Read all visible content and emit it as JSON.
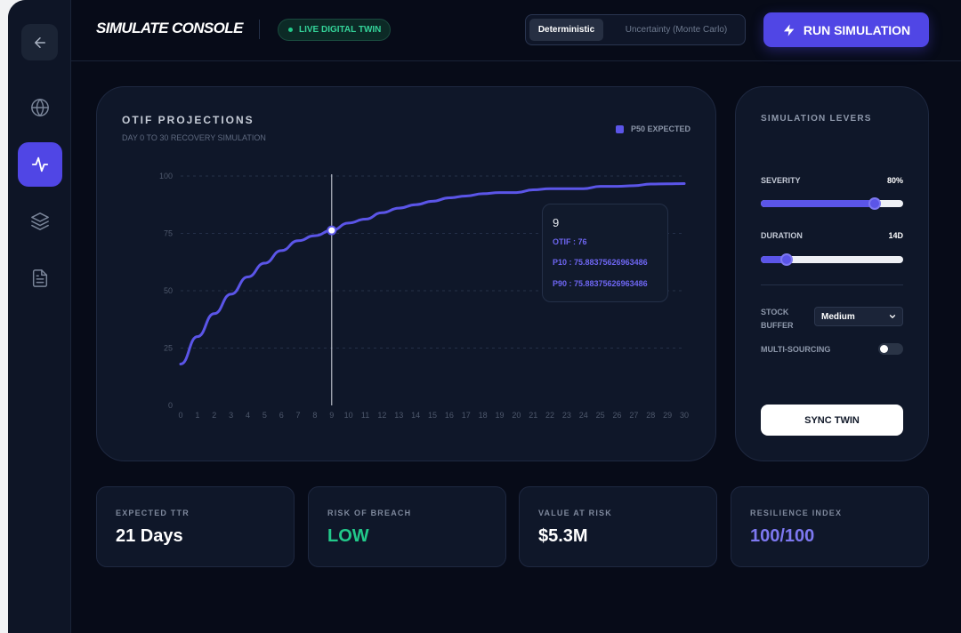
{
  "header": {
    "title": "SIMULATE CONSOLE",
    "live_badge": "LIVE DIGITAL TWIN",
    "modes": [
      "Deterministic",
      "Uncertainty (Monte Carlo)"
    ],
    "active_mode": "Deterministic",
    "run_button": "RUN SIMULATION"
  },
  "sidebar": {
    "items": [
      {
        "icon": "arrow-left-icon",
        "active": false
      },
      {
        "icon": "globe-icon",
        "active": false
      },
      {
        "icon": "activity-icon",
        "active": true
      },
      {
        "icon": "layers-icon",
        "active": false
      },
      {
        "icon": "document-icon",
        "active": false
      }
    ]
  },
  "chart_card": {
    "title": "OTIF PROJECTIONS",
    "subtitle": "DAY 0 TO 30 RECOVERY SIMULATION",
    "legend": "P50 EXPECTED"
  },
  "chart_data": {
    "type": "line",
    "x": [
      0,
      1,
      2,
      3,
      4,
      5,
      6,
      7,
      8,
      9,
      10,
      11,
      12,
      13,
      14,
      15,
      16,
      17,
      18,
      19,
      20,
      21,
      22,
      23,
      24,
      25,
      26,
      27,
      28,
      29,
      30
    ],
    "series": [
      {
        "name": "P50 EXPECTED",
        "values": [
          18,
          30,
          40,
          48.5,
          56,
          62,
          67.5,
          71.8,
          74,
          76.3,
          79.5,
          81.2,
          84,
          86,
          87.5,
          89,
          90.5,
          91.3,
          92.3,
          92.8,
          92.8,
          94,
          94.5,
          94.5,
          94.5,
          95.5,
          95.5,
          95.8,
          96.5,
          96.6,
          96.7
        ]
      }
    ],
    "xlim": [
      0,
      30
    ],
    "ylim": [
      0,
      100
    ],
    "yticks": [
      0,
      25,
      50,
      75,
      100
    ],
    "grid": true,
    "color": "#5b55e8",
    "hover_index": 9
  },
  "tooltip": {
    "title": "9",
    "otif": "OTIF : 76",
    "p10": "P10 : 75.88375626963486",
    "p90": "P90 : 75.88375626963486"
  },
  "levers": {
    "title": "SIMULATION LEVERS",
    "severity_label": "SEVERITY",
    "severity_value": "80%",
    "severity_level": 0.8,
    "duration_label": "DURATION",
    "duration_value": "14D",
    "duration_level": 0.18,
    "stock_buffer_label": "STOCK BUFFER",
    "stock_buffer_value": "Medium",
    "multisourcing_label": "MULTI-SOURCING",
    "multisourcing_on": false,
    "sync_button": "SYNC TWIN"
  },
  "stats": [
    {
      "label": "EXPECTED TTR",
      "value": "21 Days",
      "color": "#ffffff"
    },
    {
      "label": "RISK OF BREACH",
      "value": "LOW",
      "color": "#22c98a"
    },
    {
      "label": "VALUE AT RISK",
      "value": "$5.3M",
      "color": "#ffffff"
    },
    {
      "label": "RESILIENCE INDEX",
      "value": "100/100",
      "color": "#7d78f0"
    }
  ]
}
